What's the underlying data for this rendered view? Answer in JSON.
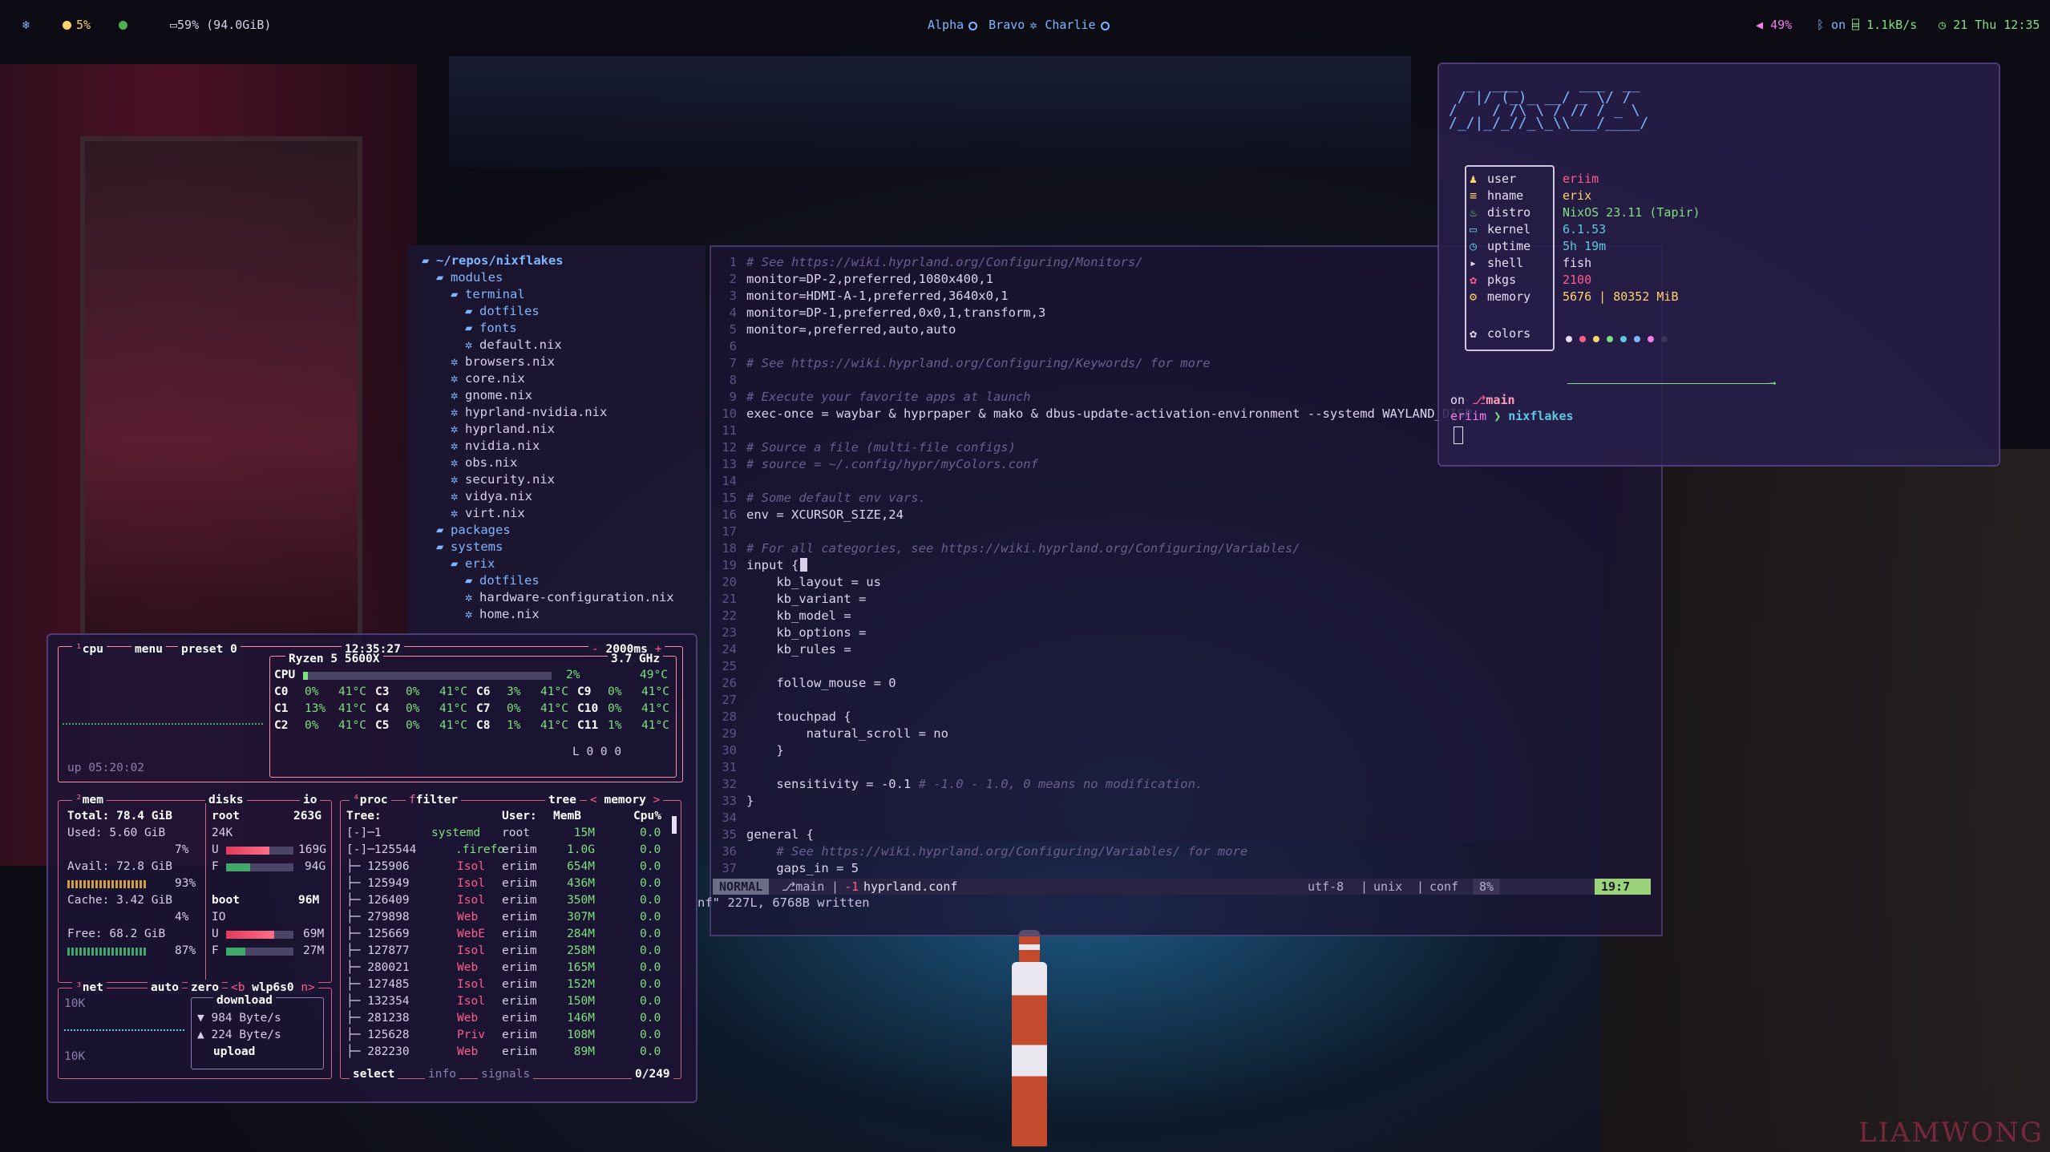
{
  "topbar": {
    "left": {
      "cpu": "5%",
      "disk": "59% (94.0GiB)"
    },
    "workspaces": [
      "Alpha",
      "Bravo",
      "Charlie"
    ],
    "right": {
      "volume": "49%",
      "bluetooth": "on",
      "net": "1.1kB/s",
      "clock": "21 Thu 12:35"
    }
  },
  "filetree": {
    "root": "~/repos/nixflakes",
    "items": [
      {
        "name": "modules",
        "type": "dir",
        "depth": 1
      },
      {
        "name": "terminal",
        "type": "dir",
        "depth": 2
      },
      {
        "name": "dotfiles",
        "type": "dir",
        "depth": 3
      },
      {
        "name": "fonts",
        "type": "dir",
        "depth": 3
      },
      {
        "name": "default.nix",
        "type": "file",
        "depth": 3
      },
      {
        "name": "browsers.nix",
        "type": "file",
        "depth": 2
      },
      {
        "name": "core.nix",
        "type": "file",
        "depth": 2
      },
      {
        "name": "gnome.nix",
        "type": "file",
        "depth": 2
      },
      {
        "name": "hyprland-nvidia.nix",
        "type": "file",
        "depth": 2
      },
      {
        "name": "hyprland.nix",
        "type": "file",
        "depth": 2
      },
      {
        "name": "nvidia.nix",
        "type": "file",
        "depth": 2
      },
      {
        "name": "obs.nix",
        "type": "file",
        "depth": 2
      },
      {
        "name": "security.nix",
        "type": "file",
        "depth": 2
      },
      {
        "name": "vidya.nix",
        "type": "file",
        "depth": 2
      },
      {
        "name": "virt.nix",
        "type": "file",
        "depth": 2
      },
      {
        "name": "packages",
        "type": "dir",
        "depth": 1
      },
      {
        "name": "systems",
        "type": "dir",
        "depth": 1
      },
      {
        "name": "erix",
        "type": "dir",
        "depth": 2
      },
      {
        "name": "dotfiles",
        "type": "dir",
        "depth": 3
      },
      {
        "name": "hardware-configuration.nix",
        "type": "file",
        "depth": 3
      },
      {
        "name": "home.nix",
        "type": "file",
        "depth": 3
      }
    ]
  },
  "editor": {
    "lines": [
      {
        "n": "1",
        "text": "# See https://wiki.hyprland.org/Configuring/Monitors/",
        "kind": "cmt"
      },
      {
        "n": "2",
        "text": "monitor=DP-2,preferred,1080x400,1",
        "kind": "txt"
      },
      {
        "n": "3",
        "text": "monitor=HDMI-A-1,preferred,3640x0,1",
        "kind": "txt"
      },
      {
        "n": "4",
        "text": "monitor=DP-1,preferred,0x0,1,transform,3",
        "kind": "txt"
      },
      {
        "n": "5",
        "text": "monitor=,preferred,auto,auto",
        "kind": "txt"
      },
      {
        "n": "6",
        "text": "",
        "kind": "txt"
      },
      {
        "n": "7",
        "text": "# See https://wiki.hyprland.org/Configuring/Keywords/ for more",
        "kind": "cmt"
      },
      {
        "n": "8",
        "text": "",
        "kind": "txt"
      },
      {
        "n": "9",
        "text": "# Execute your favorite apps at launch",
        "kind": "cmt"
      },
      {
        "n": "10",
        "text": "exec-once = waybar & hyprpaper & mako & dbus-update-activation-environment --systemd WAYLAND_DISP",
        "kind": "txt"
      },
      {
        "n": "11",
        "text": "",
        "kind": "txt"
      },
      {
        "n": "12",
        "text": "# Source a file (multi-file configs)",
        "kind": "cmt"
      },
      {
        "n": "13",
        "text": "# source = ~/.config/hypr/myColors.conf",
        "kind": "cmt"
      },
      {
        "n": "14",
        "text": "",
        "kind": "txt"
      },
      {
        "n": "15",
        "text": "# Some default env vars.",
        "kind": "cmt"
      },
      {
        "n": "16",
        "text": "env = XCURSOR_SIZE,24",
        "kind": "txt"
      },
      {
        "n": "17",
        "text": "",
        "kind": "txt"
      },
      {
        "n": "18",
        "text": "# For all categories, see https://wiki.hyprland.org/Configuring/Variables/",
        "kind": "cmt"
      },
      {
        "n": "19",
        "text": "input {",
        "kind": "txt"
      },
      {
        "n": "20",
        "text": "    kb_layout = us",
        "kind": "txt"
      },
      {
        "n": "21",
        "text": "    kb_variant =",
        "kind": "txt"
      },
      {
        "n": "22",
        "text": "    kb_model =",
        "kind": "txt"
      },
      {
        "n": "23",
        "text": "    kb_options =",
        "kind": "txt"
      },
      {
        "n": "24",
        "text": "    kb_rules =",
        "kind": "txt"
      },
      {
        "n": "25",
        "text": "",
        "kind": "txt"
      },
      {
        "n": "26",
        "text": "    follow_mouse = 0",
        "kind": "txt"
      },
      {
        "n": "27",
        "text": "",
        "kind": "txt"
      },
      {
        "n": "28",
        "text": "    touchpad {",
        "kind": "txt"
      },
      {
        "n": "29",
        "text": "        natural_scroll = no",
        "kind": "txt"
      },
      {
        "n": "30",
        "text": "    }",
        "kind": "txt"
      },
      {
        "n": "31",
        "text": "",
        "kind": "txt"
      },
      {
        "n": "32",
        "text": "    sensitivity = -0.1 ",
        "kind": "txt",
        "trail": "# -1.0 - 1.0, 0 means no modification."
      },
      {
        "n": "33",
        "text": "}",
        "kind": "txt"
      },
      {
        "n": "34",
        "text": "",
        "kind": "txt"
      },
      {
        "n": "35",
        "text": "general {",
        "kind": "txt"
      },
      {
        "n": "36",
        "text": "    # See https://wiki.hyprland.org/Configuring/Variables/ for more",
        "kind": "cmt"
      },
      {
        "n": "37",
        "text": "    gaps_in = 5",
        "kind": "txt"
      }
    ],
    "status": {
      "mode": "NORMAL",
      "branch": "main",
      "diff": "-1",
      "file": "hyprland.conf",
      "encoding": "utf-8",
      "format": "unix",
      "filetype": "conf",
      "percent": "8%",
      "position": "19:7"
    },
    "message": "nf\" 227L, 6768B written"
  },
  "fetch": {
    "ascii": "  _  ___       ___  __\n / |/ (_)_ __/ _ \\/ /\n/    / /\\ \\ / // / _ \\\n/_/|_/_//_\\_\\\\___/____/",
    "rows": [
      {
        "key": "user",
        "value": "eriim",
        "color": "#ff5c8a",
        "icon": "user-icon"
      },
      {
        "key": "hname",
        "value": "erix",
        "color": "#ffd36b",
        "icon": "host-icon"
      },
      {
        "key": "distro",
        "value": "NixOS 23.11 (Tapir)",
        "color": "#7ee07e",
        "icon": "distro-icon"
      },
      {
        "key": "kernel",
        "value": "6.1.53",
        "color": "#5ec8e0",
        "icon": "kernel-icon"
      },
      {
        "key": "uptime",
        "value": "5h 19m",
        "color": "#5ec8e0",
        "icon": "uptime-icon"
      },
      {
        "key": "shell",
        "value": "fish",
        "color": "#e6def4",
        "icon": "shell-icon"
      },
      {
        "key": "pkgs",
        "value": "2100",
        "color": "#ff5c8a",
        "icon": "pkgs-icon"
      },
      {
        "key": "memory",
        "value": "5676 | 80352 MiB",
        "color": "#ffd36b",
        "icon": "memory-icon"
      }
    ],
    "colors_label": "colors",
    "palette": [
      "#e6def4",
      "#ff5c8a",
      "#ffd36b",
      "#7ee07e",
      "#5ec8e0",
      "#7eb6ff",
      "#f07ee8",
      "#3a3356"
    ],
    "prompt": {
      "on": "on",
      "branch": "main",
      "user": "eriim",
      "dir": "nixflakes"
    }
  },
  "btop": {
    "cpu": {
      "header": {
        "cpu": "cpu",
        "menu": "menu",
        "preset": "preset 0",
        "time": "12:35:27",
        "interval": "2000ms"
      },
      "model": "Ryzen 5 5600X",
      "freq": "3.7 GHz",
      "total": {
        "label": "CPU",
        "pct": "2%",
        "temp": "49°C",
        "fill": 0.02
      },
      "cores": [
        [
          "C0",
          "0%",
          "41°C"
        ],
        [
          "C3",
          "0%",
          "41°C"
        ],
        [
          "C6",
          "3%",
          "41°C"
        ],
        [
          "C9",
          "0%",
          "41°C"
        ],
        [
          "C1",
          "13%",
          "41°C"
        ],
        [
          "C4",
          "0%",
          "41°C"
        ],
        [
          "C7",
          "0%",
          "41°C"
        ],
        [
          "C10",
          "0%",
          "41°C"
        ],
        [
          "C2",
          "0%",
          "41°C"
        ],
        [
          "C5",
          "0%",
          "41°C"
        ],
        [
          "C8",
          "1%",
          "41°C"
        ],
        [
          "C11",
          "1%",
          "41°C"
        ]
      ],
      "load": "L 0 0 0",
      "uptime": "up 05:20:02"
    },
    "mem": {
      "title": "mem",
      "disks": "disks",
      "io": "io",
      "total": "Total: 78.4 GiB",
      "used": "Used:  5.60 GiB",
      "used_pct": "7%",
      "used_fill": 0.07,
      "avail": "Avail: 72.8 GiB",
      "avail_pct": "93%",
      "cache": "Cache: 3.42 GiB",
      "cache_pct": "4%",
      "free": "Free:  68.2 GiB",
      "free_pct": "87%",
      "disk_root": {
        "name": "root",
        "size": "263G",
        "io": "24K",
        "used": "169G",
        "free": "94G",
        "used_fill": 0.64
      },
      "disk_boot": {
        "name": "boot",
        "size": "96M",
        "io": "IO",
        "used": "69M",
        "free": "27M",
        "used_fill": 0.72
      }
    },
    "net": {
      "title": "net",
      "auto": "auto",
      "zero": "zero",
      "iface": "wlp6s0",
      "top": "10K",
      "bottom": "10K",
      "download": "download",
      "down_rate": "984 Byte/s",
      "up_rate": "224 Byte/s",
      "upload": "upload"
    },
    "proc": {
      "title": "proc",
      "filter": "filter",
      "tree": "tree",
      "sort": "memory",
      "headers": {
        "tree": "Tree:",
        "user": "User:",
        "mem": "MemB",
        "cpu": "Cpu%"
      },
      "rows": [
        {
          "tree": "[-]─1",
          "name": "systemd",
          "user": "root",
          "mem": "15M",
          "cpu": "0.0"
        },
        {
          "tree": " [-]─125544",
          "name": ".firefo",
          "user": "eriim",
          "mem": "1.0G",
          "cpu": "0.0"
        },
        {
          "tree": "   ├─ 125906",
          "name": "Isol",
          "user": "eriim",
          "mem": "654M",
          "cpu": "0.0"
        },
        {
          "tree": "   ├─ 125949",
          "name": "Isol",
          "user": "eriim",
          "mem": "436M",
          "cpu": "0.0"
        },
        {
          "tree": "   ├─ 126409",
          "name": "Isol",
          "user": "eriim",
          "mem": "350M",
          "cpu": "0.0"
        },
        {
          "tree": "   ├─ 279898",
          "name": "Web",
          "user": "eriim",
          "mem": "307M",
          "cpu": "0.0"
        },
        {
          "tree": "   ├─ 125669",
          "name": "WebE",
          "user": "eriim",
          "mem": "284M",
          "cpu": "0.0"
        },
        {
          "tree": "   ├─ 127877",
          "name": "Isol",
          "user": "eriim",
          "mem": "258M",
          "cpu": "0.0"
        },
        {
          "tree": "   ├─ 280021",
          "name": "Web",
          "user": "eriim",
          "mem": "165M",
          "cpu": "0.0"
        },
        {
          "tree": "   ├─ 127485",
          "name": "Isol",
          "user": "eriim",
          "mem": "152M",
          "cpu": "0.0"
        },
        {
          "tree": "   ├─ 132354",
          "name": "Isol",
          "user": "eriim",
          "mem": "150M",
          "cpu": "0.0"
        },
        {
          "tree": "   ├─ 281238",
          "name": "Web",
          "user": "eriim",
          "mem": "146M",
          "cpu": "0.0"
        },
        {
          "tree": "   ├─ 125628",
          "name": "Priv",
          "user": "eriim",
          "mem": "108M",
          "cpu": "0.0"
        },
        {
          "tree": "   ├─ 282230",
          "name": "Web",
          "user": "eriim",
          "mem": "89M",
          "cpu": "0.0"
        }
      ],
      "footer": {
        "select": "select",
        "info": "info",
        "signals": "signals",
        "count": "0/249"
      }
    }
  },
  "watermark": "LIAMWONG"
}
